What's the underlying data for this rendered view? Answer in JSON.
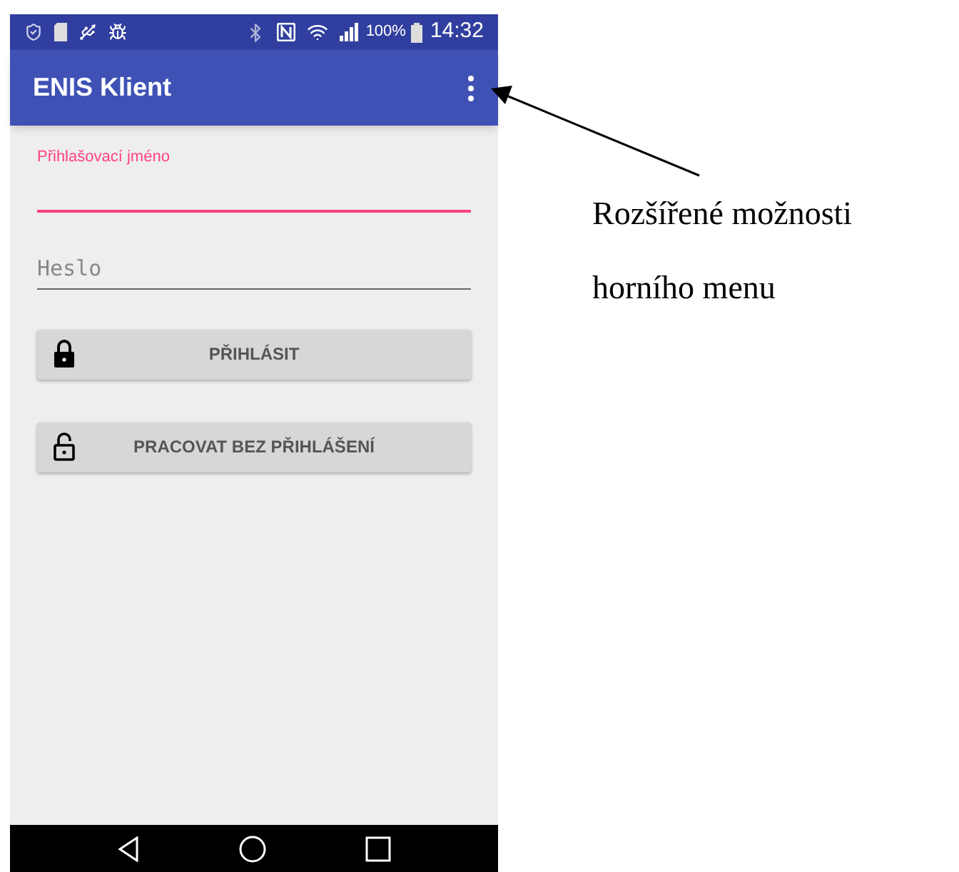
{
  "status_bar": {
    "battery": "100%",
    "time": "14:32"
  },
  "app_bar": {
    "title": "ENIS Klient"
  },
  "fields": [
    {
      "label": "Přihlašovací jméno",
      "focused": true
    },
    {
      "placeholder": "Heslo",
      "focused": false
    }
  ],
  "buttons": [
    {
      "label": "PŘIHLÁSIT",
      "kind": "locked"
    },
    {
      "label": "PRACOVAT BEZ PŘIHLÁŠENÍ",
      "kind": "unlocked"
    }
  ],
  "annotation": {
    "lines": [
      "Rozšířené možnosti",
      "horního menu"
    ]
  }
}
